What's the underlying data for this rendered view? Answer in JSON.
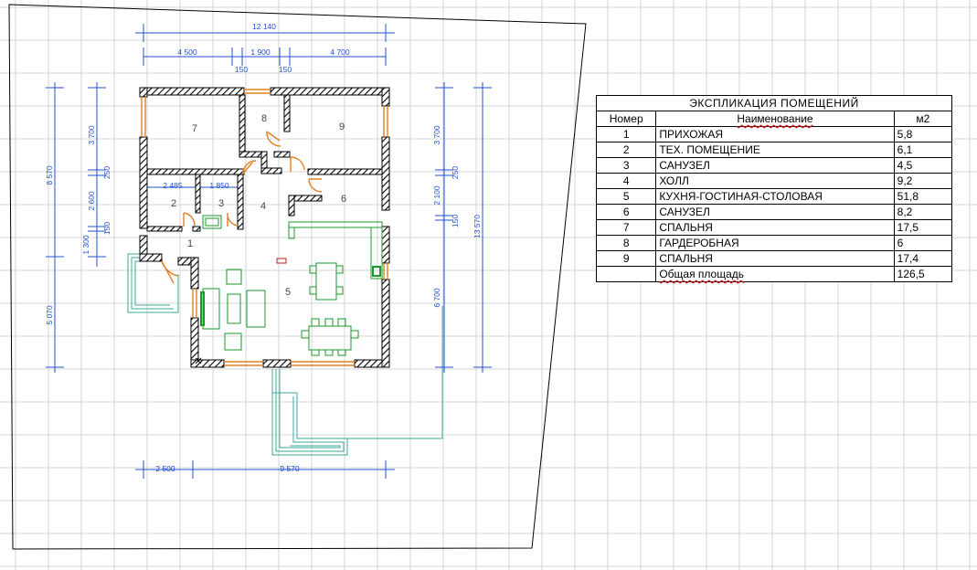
{
  "plan": {
    "overall_dimension": "12 140",
    "top_segments": [
      "4 500",
      "1 900",
      "4 700"
    ],
    "top_small": [
      "150",
      "150"
    ],
    "bottom_segments": [
      "2 500",
      "9 570"
    ],
    "left_outer": [
      "8 570",
      "5 070"
    ],
    "left_inner": [
      "3 700",
      "2 600",
      "1 300"
    ],
    "left_small": [
      "250",
      "150"
    ],
    "right_outer": "13 570",
    "right_inner": [
      "3 700",
      "2 100",
      "6 700"
    ],
    "right_small": [
      "250",
      "150"
    ],
    "inner_dims": [
      "2 485",
      "1 850"
    ],
    "room_numbers": [
      "1",
      "2",
      "3",
      "4",
      "5",
      "6",
      "7",
      "8",
      "9"
    ]
  },
  "explication": {
    "title": "ЭКСПЛИКАЦИЯ  ПОМЕЩЕНИЙ",
    "headers": {
      "num": "Номер",
      "name": "Наименование",
      "area": "м2"
    },
    "rows": [
      {
        "num": "1",
        "name": "ПРИХОЖАЯ",
        "area": "5,8"
      },
      {
        "num": "2",
        "name": "ТЕХ. ПОМЕЩЕНИЕ",
        "area": "6,1"
      },
      {
        "num": "3",
        "name": "САНУЗЕЛ",
        "area": "4,5"
      },
      {
        "num": "4",
        "name": "ХОЛЛ",
        "area": "9,2"
      },
      {
        "num": "5",
        "name": "КУХНЯ-ГОСТИНАЯ-СТОЛОВАЯ",
        "area": "51,8"
      },
      {
        "num": "6",
        "name": "САНУЗЕЛ",
        "area": "8,2"
      },
      {
        "num": "7",
        "name": "СПАЛЬНЯ",
        "area": "17,5"
      },
      {
        "num": "8",
        "name": "ГАРДЕРОБНАЯ",
        "area": "6"
      },
      {
        "num": "9",
        "name": "СПАЛЬНЯ",
        "area": "17,4"
      }
    ],
    "total": {
      "num": "",
      "name": "Общая площадь",
      "area": "126,5"
    }
  },
  "colors": {
    "dimension": "#2050d0",
    "wall": "#000000",
    "door": "#e08020",
    "furniture": "#1a9a2a",
    "site": "#3aaa9a",
    "grid": "#d6d6d6"
  }
}
